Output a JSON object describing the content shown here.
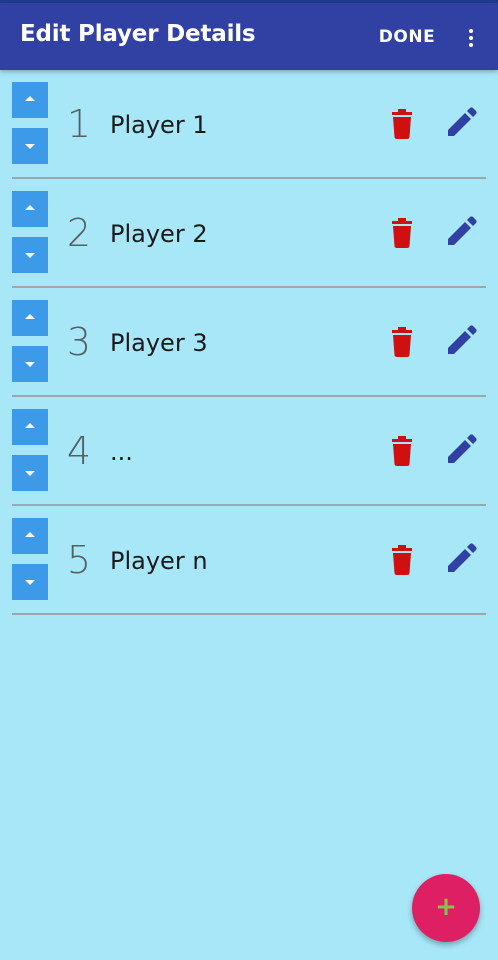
{
  "app_bar": {
    "title": "Edit Player Details",
    "done_label": "DONE",
    "overflow_icon": "more-vert-icon",
    "background": "#3141a3"
  },
  "players": [
    {
      "number": "1",
      "name": "Player 1"
    },
    {
      "number": "2",
      "name": "Player 2"
    },
    {
      "number": "3",
      "name": "Player 3"
    },
    {
      "number": "4",
      "name": "..."
    },
    {
      "number": "5",
      "name": "Player n"
    }
  ],
  "row_icons": {
    "move_up": "arrow-up-icon",
    "move_down": "arrow-down-icon",
    "delete": "trash-icon",
    "edit": "pencil-icon"
  },
  "fab": {
    "label": "+",
    "icon": "add-icon"
  },
  "colors": {
    "background": "#a7e7f8",
    "move_button": "#3d9ae8",
    "delete": "#d01010",
    "edit": "#3141a3",
    "fab": "#df1f63",
    "fab_plus": "#8bc34a"
  }
}
